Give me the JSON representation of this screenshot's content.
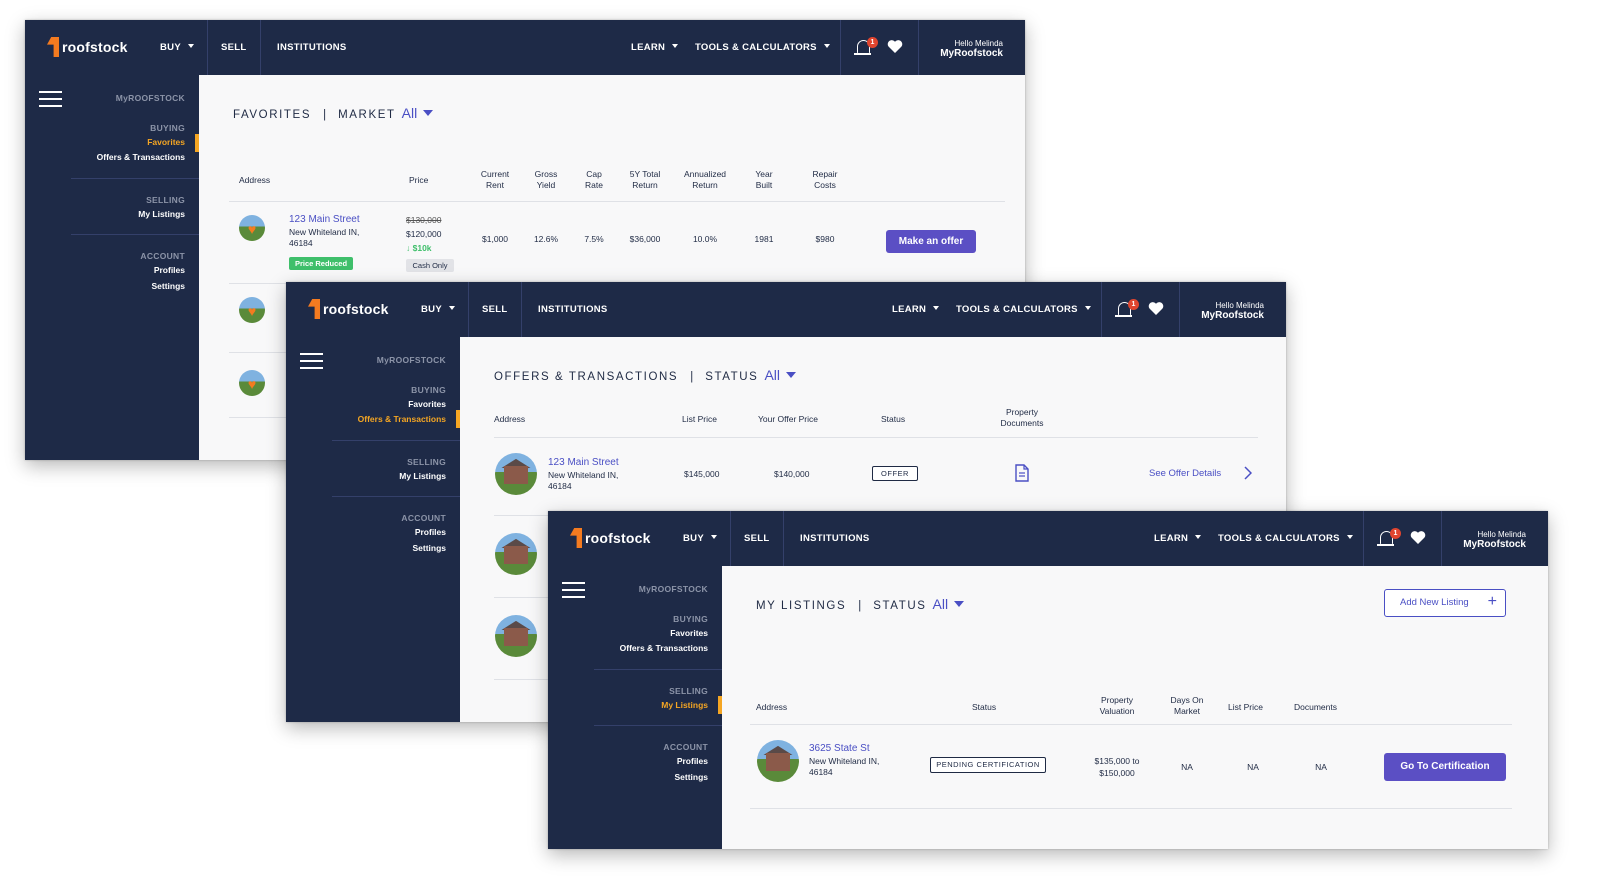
{
  "nav": {
    "brand": "roofstock",
    "buy": "BUY",
    "sell": "SELL",
    "institutions": "INSTITUTIONS",
    "learn": "LEARN",
    "tools": "TOOLS & CALCULATORS",
    "notification_count": "1",
    "hello": "Hello Melinda"
  },
  "sidebar": {
    "buying": "BUYING",
    "favorites": "Favorites",
    "offers": "Offers & Transactions",
    "selling": "SELLING",
    "my_listings": "My Listings",
    "account": "ACCOUNT",
    "profiles": "Profiles",
    "settings": "Settings"
  },
  "win1": {
    "nav_my": "MyRoofstock",
    "sidebar_title": "MyROOFSTOCK",
    "title": "FAVORITES",
    "sep": "|",
    "filter_label": "MARKET",
    "filter_value": "All",
    "columns": {
      "address": "Address",
      "price": "Price",
      "current_rent_1": "Current",
      "current_rent_2": "Rent",
      "gross_yield_1": "Gross",
      "gross_yield_2": "Yield",
      "cap_rate_1": "Cap",
      "cap_rate_2": "Rate",
      "total_return_1": "5Y Total",
      "total_return_2": "Return",
      "annualized_1": "Annualized",
      "annualized_2": "Return",
      "year_built_1": "Year",
      "year_built_2": "Built",
      "repair_1": "Repair",
      "repair_2": "Costs"
    },
    "row": {
      "street": "123 Main Street",
      "city": "New Whiteland IN,",
      "zip": "46184",
      "tag": "Price Reduced",
      "old_price": "$130,000",
      "price": "$120,000",
      "reduction": "$10k",
      "cash_only": "Cash Only",
      "current_rent": "$1,000",
      "gross_yield": "12.6%",
      "cap_rate": "7.5%",
      "total_return": "$36,000",
      "annualized": "10.0%",
      "year_built": "1981",
      "repair": "$980",
      "action": "Make an offer"
    }
  },
  "win2": {
    "nav_my": "MyRoofstock",
    "sidebar_title": "MyROOFSTOCK",
    "title": "OFFERS & TRANSACTIONS",
    "sep": "|",
    "filter_label": "STATUS",
    "filter_value": "All",
    "columns": {
      "address": "Address",
      "list_price": "List Price",
      "offer_price": "Your Offer Price",
      "status": "Status",
      "docs_1": "Property",
      "docs_2": "Documents"
    },
    "row": {
      "street": "123 Main Street",
      "city": "New Whiteland IN,",
      "zip": "46184",
      "list_price": "$145,000",
      "offer_price": "$140,000",
      "status": "OFFER",
      "action": "See Offer Details"
    }
  },
  "win3": {
    "nav_my": "MyRoofstock",
    "sidebar_title": "MyROOFSTOCK",
    "title": "MY LISTINGS",
    "sep": "|",
    "filter_label": "STATUS",
    "filter_value": "All",
    "add_listing": "Add New Listing",
    "columns": {
      "address": "Address",
      "status": "Status",
      "valuation_1": "Property",
      "valuation_2": "Valuation",
      "dom_1": "Days On",
      "dom_2": "Market",
      "list_price": "List Price",
      "documents": "Documents"
    },
    "row": {
      "street": "3625 State St",
      "city": "New Whiteland IN,",
      "zip": "46184",
      "status": "PENDING CERTIFICATION",
      "valuation_1": "$135,000 to",
      "valuation_2": "$150,000",
      "dom": "NA",
      "list_price": "NA",
      "documents": "NA",
      "action": "Go To Certification"
    }
  },
  "colors": {
    "navy": "#1e2a47",
    "accent_orange": "#f5a623",
    "brand_orange": "#f47b20",
    "purple": "#5b4fc4",
    "green": "#3fbf6b",
    "badge_red": "#e0452f"
  },
  "icons": [
    "hamburger-icon",
    "bell-icon",
    "heart-icon",
    "document-icon",
    "chevron-right-icon",
    "plus-icon",
    "arrow-down-icon",
    "caret-down-icon"
  ]
}
